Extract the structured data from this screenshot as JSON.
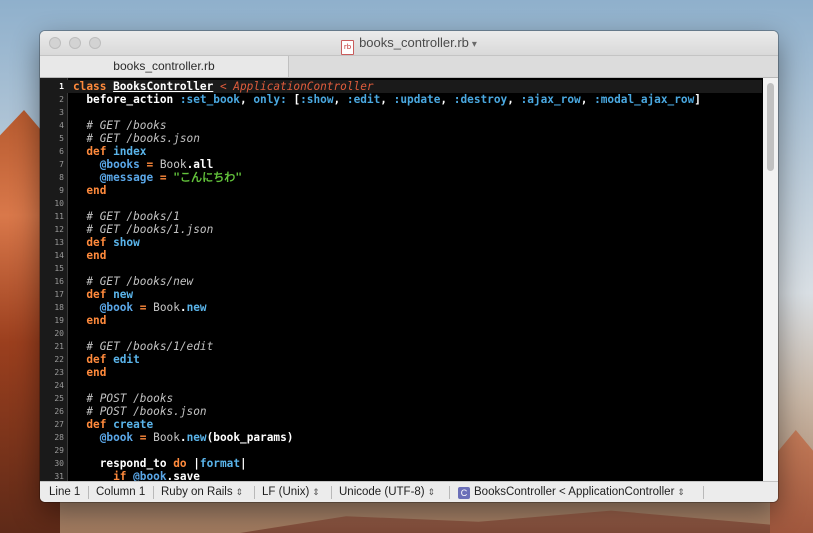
{
  "window": {
    "title": "books_controller.rb",
    "title_icon": "rb",
    "title_chevron": "⌄"
  },
  "tabs": [
    {
      "label": "books_controller.rb"
    }
  ],
  "editor": {
    "current_line": 1,
    "lines": [
      {
        "n": "1"
      },
      {
        "n": "2"
      },
      {
        "n": "3"
      },
      {
        "n": "4"
      },
      {
        "n": "5"
      },
      {
        "n": "6"
      },
      {
        "n": "7"
      },
      {
        "n": "8"
      },
      {
        "n": "9"
      },
      {
        "n": "10"
      },
      {
        "n": "11"
      },
      {
        "n": "12"
      },
      {
        "n": "13"
      },
      {
        "n": "14"
      },
      {
        "n": "15"
      },
      {
        "n": "16"
      },
      {
        "n": "17"
      },
      {
        "n": "18"
      },
      {
        "n": "19"
      },
      {
        "n": "20"
      },
      {
        "n": "21"
      },
      {
        "n": "22"
      },
      {
        "n": "23"
      },
      {
        "n": "24"
      },
      {
        "n": "25"
      },
      {
        "n": "26"
      },
      {
        "n": "27"
      },
      {
        "n": "28"
      },
      {
        "n": "29"
      },
      {
        "n": "30"
      },
      {
        "n": "31"
      }
    ],
    "code": {
      "l1": [
        "class ",
        "BooksController",
        " < ApplicationController"
      ],
      "l2": [
        "before_action ",
        ":set_book",
        ", ",
        "only:",
        " [",
        ":show",
        ", ",
        ":edit",
        ", ",
        ":update",
        ", ",
        ":destroy",
        ", ",
        ":ajax_row",
        ", ",
        ":modal_ajax_row",
        "]"
      ],
      "l4": "# GET /books",
      "l5": "# GET /books.json",
      "l6": [
        "def ",
        "index"
      ],
      "l7": [
        "@books",
        " = ",
        "Book",
        ".all"
      ],
      "l8": [
        "@message",
        " = ",
        "\"こんにちわ\""
      ],
      "l9": "end",
      "l11": "# GET /books/1",
      "l12": "# GET /books/1.json",
      "l13": [
        "def ",
        "show"
      ],
      "l14": "end",
      "l16": "# GET /books/new",
      "l17": [
        "def ",
        "new"
      ],
      "l18": [
        "@book",
        " = ",
        "Book",
        ".",
        "new"
      ],
      "l19": "end",
      "l21": "# GET /books/1/edit",
      "l22": [
        "def ",
        "edit"
      ],
      "l23": "end",
      "l25": "# POST /books",
      "l26": "# POST /books.json",
      "l27": [
        "def ",
        "create"
      ],
      "l28": [
        "@book",
        " = ",
        "Book",
        ".",
        "new",
        "(book_params)"
      ],
      "l30": [
        "respond_to ",
        "do",
        " |",
        "format",
        "|"
      ],
      "l31": [
        "if ",
        "@book",
        ".save"
      ]
    }
  },
  "statusbar": {
    "line": "Line 1",
    "column": "Column 1",
    "syntax": "Ruby on Rails",
    "line_endings": "LF (Unix)",
    "encoding": "Unicode (UTF-8)",
    "symbol_icon": "C",
    "symbol": "BooksController < ApplicationController",
    "updown_glyph": "⌃⌄"
  }
}
